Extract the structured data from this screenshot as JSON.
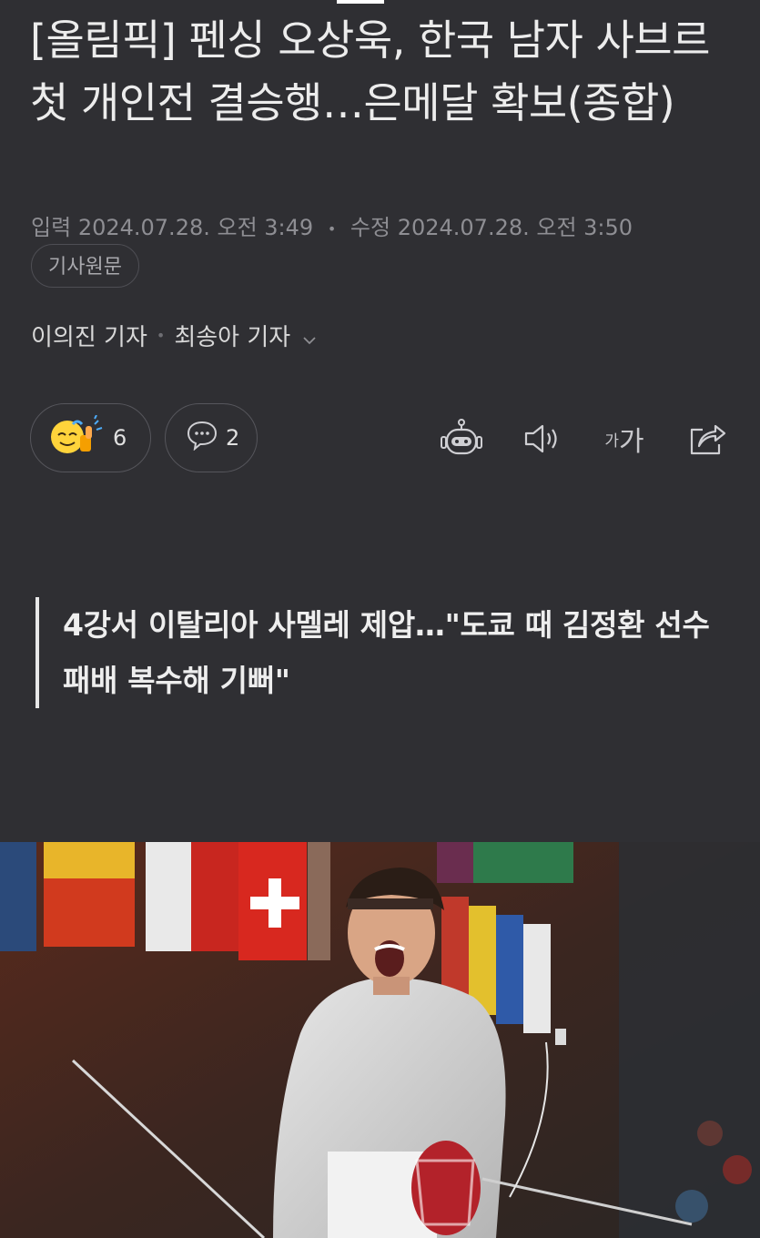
{
  "article": {
    "title": "[올림픽] 펜싱 오상욱, 한국 남자 사브르 첫 개인전 결승행…은메달 확보(종합)",
    "published_label": "입력",
    "published": "2024.07.28. 오전 3:49",
    "modified_label": "수정",
    "modified": "2024.07.28. 오전 3:50",
    "source_button": "기사원문",
    "reporters": [
      "이의진 기자",
      "최송아 기자"
    ],
    "subheadline": "4강서 이탈리아 사멜레 제압…\"도쿄 때 김정환 선수 패배 복수해 기뻐\""
  },
  "actions": {
    "reaction_count": "6",
    "comment_count": "2",
    "font_small": "가",
    "font_big": "가"
  },
  "icons": {
    "reaction": "smiley-thumbsup-icon",
    "comment": "comment-bubble-icon",
    "summary": "robot-icon",
    "tts": "speaker-icon",
    "share": "share-icon",
    "reporter_expand": "chevron-down-icon"
  },
  "colors": {
    "background": "#2f2f33",
    "text": "#ececec",
    "muted": "#8e8e93",
    "emoji_yellow": "#ffd43b"
  }
}
